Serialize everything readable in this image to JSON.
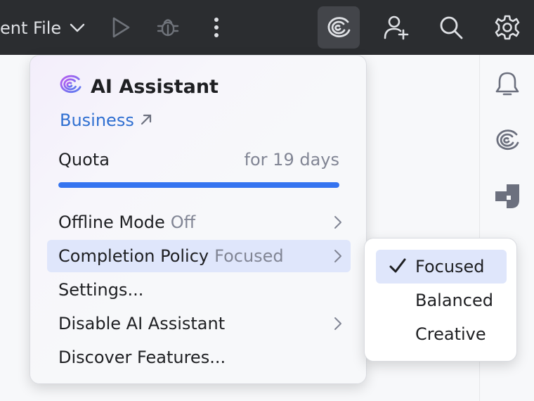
{
  "toolbar": {
    "run_config_label": "ent File",
    "icons": [
      "chevron-down-icon",
      "run-icon",
      "debug-icon",
      "more-vertical-icon",
      "ai-assistant-icon",
      "add-user-icon",
      "search-icon",
      "settings-gear-icon"
    ]
  },
  "right_strip": {
    "icons": [
      "notifications-bell-icon",
      "ai-assistant-icon",
      "ai-chat-icon"
    ]
  },
  "popup": {
    "title": "AI Assistant",
    "plan_label": "Business",
    "quota_label": "Quota",
    "quota_days": "for 19 days",
    "quota_fraction": 1.0,
    "menu": [
      {
        "label": "Offline Mode",
        "value": "Off",
        "has_submenu": true
      },
      {
        "label": "Completion Policy",
        "value": "Focused",
        "has_submenu": true,
        "selected": true
      },
      {
        "label": "Settings...",
        "value": "",
        "has_submenu": false
      },
      {
        "label": "Disable AI Assistant",
        "value": "",
        "has_submenu": true
      },
      {
        "label": "Discover Features...",
        "value": "",
        "has_submenu": false
      }
    ]
  },
  "submenu": {
    "items": [
      {
        "label": "Focused",
        "checked": true
      },
      {
        "label": "Balanced",
        "checked": false
      },
      {
        "label": "Creative",
        "checked": false
      }
    ]
  },
  "colors": {
    "toolbar_bg": "#2b2d30",
    "accent_blue": "#3574f0",
    "link_blue": "#2f6fd1",
    "selection": "#dfe6fb",
    "muted_text": "#818594",
    "ai_gradient_start": "#b85cf0",
    "ai_gradient_end": "#5a7cf0"
  }
}
